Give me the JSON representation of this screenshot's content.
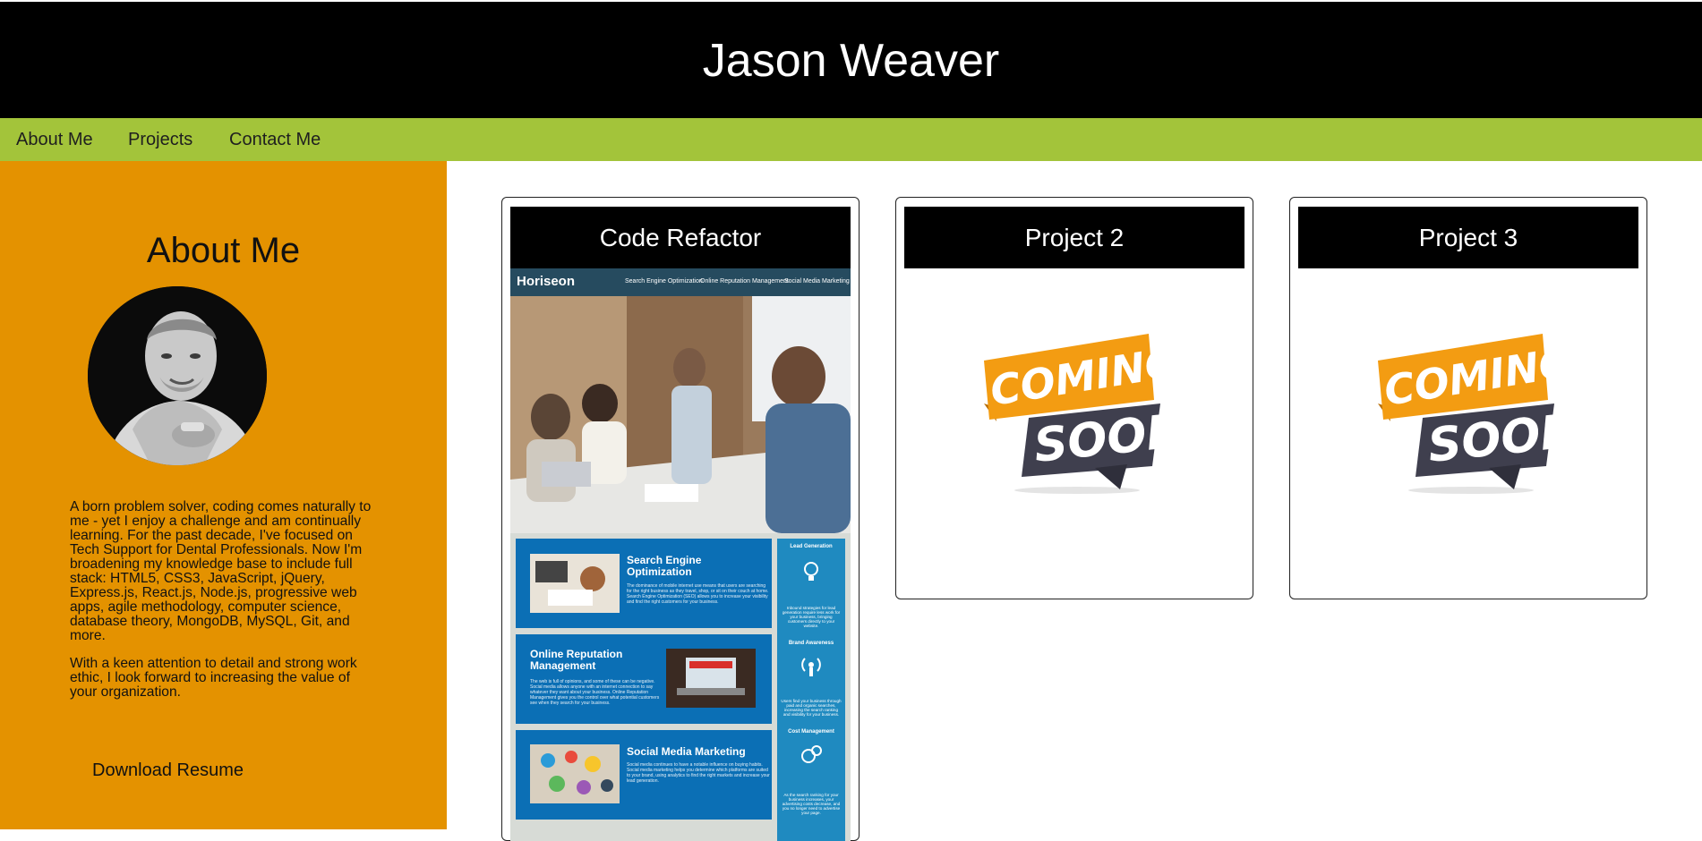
{
  "header": {
    "title": "Jason Weaver"
  },
  "nav": {
    "items": [
      "About Me",
      "Projects",
      "Contact Me"
    ]
  },
  "about": {
    "heading": "About Me",
    "paragraphs": [
      "A born problem solver, coding comes naturally to me - yet I enjoy a challenge and am continually learning. For the past decade, I've focused on Tech Support for Dental Professionals. Now I'm broadening my knowledge base to include full stack: HTML5, CSS3, JavaScript, jQuery, Express.js, React.js, Node.js, progressive web apps, agile methodology, computer science, database theory, MongoDB, MySQL, Git, and more.",
      "With a keen attention to detail and strong work ethic, I look forward to increasing the value of your organization."
    ],
    "resume_label": "Download Resume"
  },
  "projects": [
    {
      "title": "Code Refactor",
      "preview": {
        "brand": "Horiseon",
        "menu": [
          "Search Engine Optimization",
          "Online Reputation Management",
          "Social Media Marketing"
        ],
        "blocks": [
          {
            "title": "Search Engine Optimization",
            "text": "The dominance of mobile internet use means that users are searching for the right business as they travel, shop, or sit on their couch at home. Search Engine Optimization (SEO) allows you to increase your visibility and find the right customers for your business."
          },
          {
            "title": "Online Reputation Management",
            "text": "The web is full of opinions, and some of these can be negative. Social media allows anyone with an internet connection to say whatever they want about your business. Online Reputation Management gives you the control over what potential customers see when they search for your business."
          },
          {
            "title": "Social Media Marketing",
            "text": "Social media continues to have a notable influence on buying habits. Social media marketing helps you determine which platforms are suited to your brand, using analytics to find the right markets and increase your lead generation."
          }
        ],
        "side": [
          {
            "title": "Lead Generation",
            "text": "Inbound strategies for lead generation require less work for your business, bringing customers directly to your website."
          },
          {
            "title": "Brand Awareness",
            "text": "Users find your business through paid and organic searches, increasing the search ranking and visibility for your business."
          },
          {
            "title": "Cost Management",
            "text": "As the search ranking for your business increases, your advertising costs decrease, and you no longer need to advertise your page."
          }
        ]
      }
    },
    {
      "title": "Project 2",
      "badge": [
        "COMING",
        "SOON"
      ]
    },
    {
      "title": "Project 3",
      "badge": [
        "COMING",
        "SOON"
      ]
    }
  ],
  "colors": {
    "header_bg": "#000000",
    "nav_bg": "#a3c43a",
    "about_bg": "#e49200",
    "badge_orange": "#f39c12",
    "badge_dark": "#3f3f4e"
  }
}
